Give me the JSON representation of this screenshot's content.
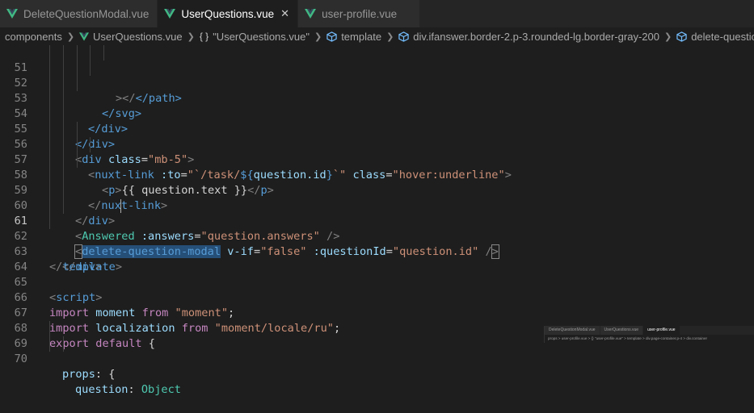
{
  "tabs": [
    {
      "label": "DeleteQuestionModal.vue",
      "active": false,
      "closable": false
    },
    {
      "label": "UserQuestions.vue",
      "active": true,
      "closable": true
    },
    {
      "label": "user-profile.vue",
      "active": false,
      "closable": false
    }
  ],
  "breadcrumb": {
    "folder": "components",
    "file": "UserQuestions.vue",
    "object": "\"UserQuestions.vue\"",
    "template": "template",
    "div": "div.ifanswer.border-2.p-3.rounded-lg.border-gray-200",
    "last": "delete-question-modal"
  },
  "editor": {
    "line_numbers": [
      "51",
      "52",
      "53",
      "54",
      "55",
      "56",
      "57",
      "58",
      "59",
      "60",
      "61",
      "62",
      "63",
      "64",
      "65",
      "66",
      "67",
      "68",
      "69",
      "70"
    ],
    "current_line": "61"
  },
  "code": {
    "l51": "</path>",
    "l52": "</svg>",
    "l53": "</div>",
    "l54": "</div>",
    "l55_tag": "div",
    "l55_attr": "class",
    "l55_val": "\"mb-5\"",
    "l56_tag": "nuxt-link",
    "l56_attr1": ":to",
    "l56_val1a": "\"`/task/",
    "l56_expr_open": "${",
    "l56_expr": "question.id",
    "l56_expr_close": "}",
    "l56_val1b": "`\"",
    "l56_attr2": "class",
    "l56_val2": "\"hover:underline\"",
    "l57_tag": "p",
    "l57_text": "{{ question.text }}",
    "l58_tag": "nuxt-link",
    "l59_tag": "div",
    "l60_comp": "Answered",
    "l60_attr": ":answers",
    "l60_val": "\"question.answers\"",
    "l61_tag": "delete-question-modal",
    "l61_attr1": "v-if",
    "l61_val1": "\"false\"",
    "l61_attr2": ":questionId",
    "l61_val2": "\"question.id\"",
    "l62_tag": "div",
    "l63_tag": "template",
    "l65_tag": "script",
    "l66_kw": "import",
    "l66_name": "moment",
    "l66_from": "from",
    "l66_str": "\"moment\"",
    "l67_kw": "import",
    "l67_name": "localization",
    "l67_from": "from",
    "l67_str": "\"moment/locale/ru\"",
    "l68_kw1": "export",
    "l68_kw2": "default",
    "l69_prop": "props",
    "l70_prop": "question",
    "l70_type": "Object"
  },
  "mini": {
    "tabs": [
      "DeleteQuestionModal.vue",
      "UserQuestions.vue",
      "user-profile.vue"
    ],
    "crumb": "props > user-profile.vue > {} \"user-profile.vue\" > template > div.page-container.p-4 > div.container"
  },
  "colors": {
    "vue_green": "#41b883",
    "tag": "#569cd6",
    "attr": "#9cdcfe",
    "string": "#ce9178",
    "keyword": "#c586c0",
    "component": "#4ec9b0"
  }
}
